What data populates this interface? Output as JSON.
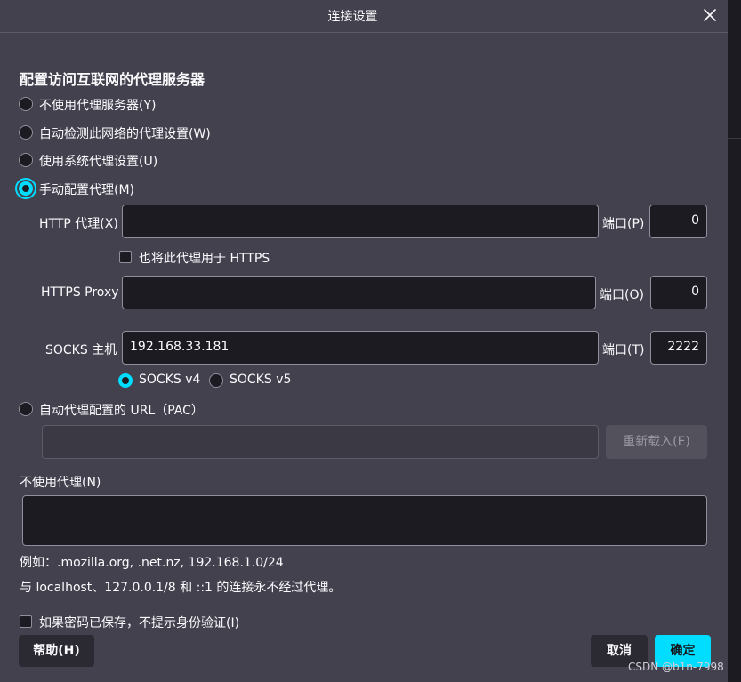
{
  "dialog": {
    "title": "连接设置",
    "heading": "配置访问互联网的代理服务器"
  },
  "proxy_options": [
    {
      "label": "不使用代理服务器(Y)",
      "checked": false
    },
    {
      "label": "自动检测此网络的代理设置(W)",
      "checked": false
    },
    {
      "label": "使用系统代理设置(U)",
      "checked": false
    },
    {
      "label": "手动配置代理(M)",
      "checked": true
    }
  ],
  "http": {
    "label": "HTTP 代理(X)",
    "value": "",
    "port_label": "端口(P)",
    "port": "0",
    "also_https_label": "也将此代理用于 HTTPS",
    "also_https_checked": false
  },
  "https": {
    "label": "HTTPS Proxy",
    "value": "",
    "port_label": "端口(O)",
    "port": "0"
  },
  "socks": {
    "label": "SOCKS 主机",
    "value": "192.168.33.181",
    "port_label": "端口(T)",
    "port": "2222",
    "v4_label": "SOCKS v4",
    "v5_label": "SOCKS v5",
    "selected": "v4"
  },
  "pac": {
    "label": "自动代理配置的 URL（PAC）",
    "value": "",
    "reload_label": "重新载入(E)"
  },
  "no_proxy": {
    "label": "不使用代理(N)",
    "value": "",
    "example": "例如：.mozilla.org, .net.nz, 192.168.1.0/24",
    "note": "与 localhost、127.0.0.1/8 和 ::1 的连接永不经过代理。"
  },
  "auth": {
    "label": "如果密码已保存，不提示身份验证(I)",
    "checked": false
  },
  "buttons": {
    "help": "帮助(H)",
    "cancel": "取消",
    "ok": "确定"
  },
  "watermark": "CSDN @b1n-7998",
  "icons": {
    "close": "close-icon"
  },
  "colors": {
    "accent": "#00ddff",
    "dialog_bg": "#42414d",
    "input_bg": "#1c1b22"
  }
}
